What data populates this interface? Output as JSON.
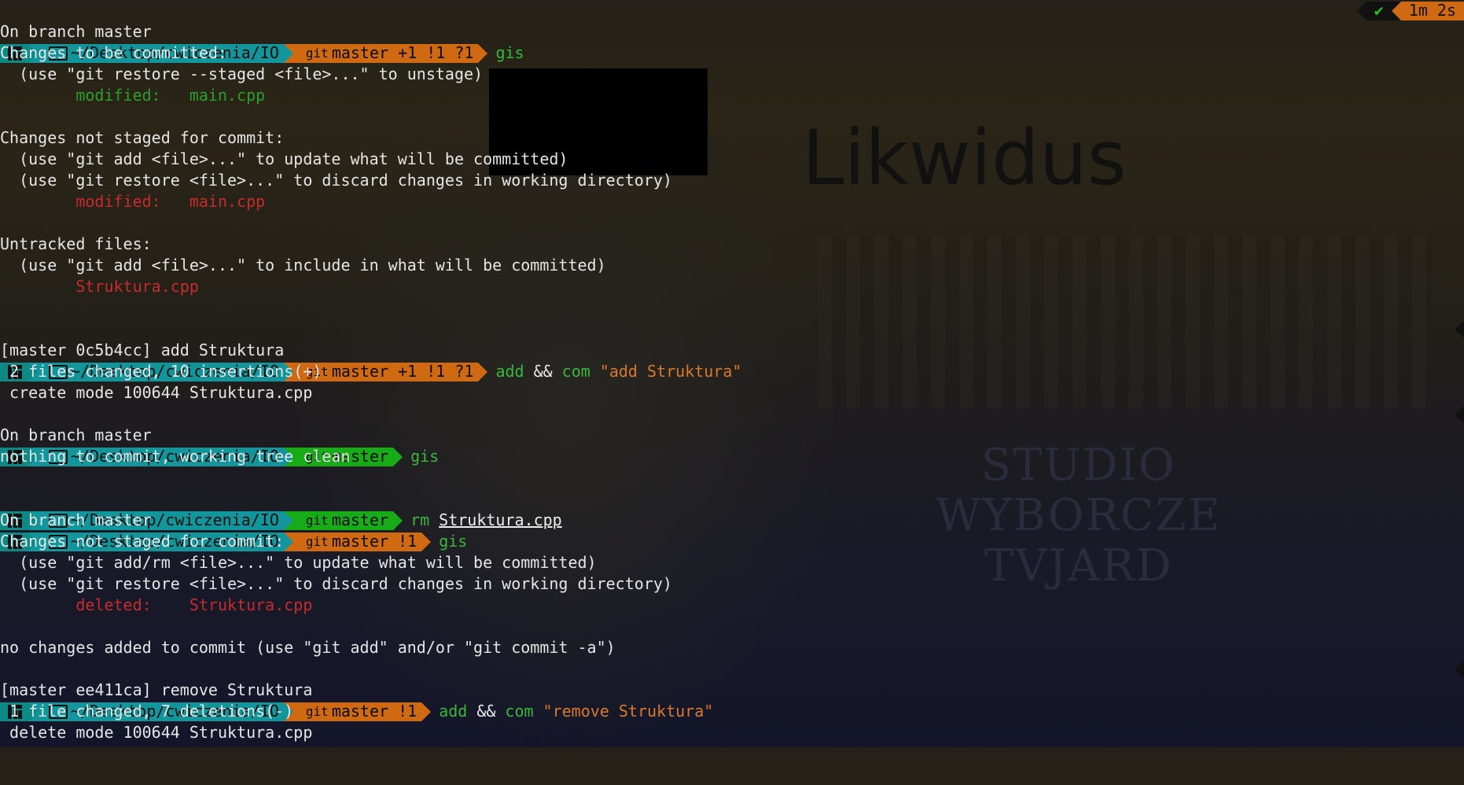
{
  "background": {
    "title": "Likwidus",
    "studio_lines": [
      "STUDIO",
      "WYBORCZE",
      "TVJARD"
    ]
  },
  "prompt": {
    "dir": "~/Desktop/cwiczenia/IO",
    "git_label": "git"
  },
  "right_status": {
    "ok": "✔",
    "time": "1m 2s"
  },
  "lines": {
    "p1": {
      "branch": "master +1 !1 ?1",
      "cmd": "gis"
    },
    "l2": "On branch master",
    "l3": "Changes to be committed:",
    "l4": "  (use \"git restore --staged <file>...\" to unstage)",
    "l5_label": "        modified:   ",
    "l5_file": "main.cpp",
    "l7": "Changes not staged for commit:",
    "l8": "  (use \"git add <file>...\" to update what will be committed)",
    "l9": "  (use \"git restore <file>...\" to discard changes in working directory)",
    "l10_label": "        modified:   ",
    "l10_file": "main.cpp",
    "l12": "Untracked files:",
    "l13": "  (use \"git add <file>...\" to include in what will be committed)",
    "l14": "        Struktura.cpp",
    "p2": {
      "branch": "master +1 !1 ?1",
      "cmd1": "add",
      "op": "&&",
      "cmd2": "com",
      "arg": "\"add Struktura\""
    },
    "l16": "[master 0c5b4cc] add Struktura",
    "l17": " 2 files changed, 10 insertions(+)",
    "l18": " create mode 100644 Struktura.cpp",
    "p3": {
      "branch": "master",
      "cmd": "gis"
    },
    "l20": "On branch master",
    "l21": "nothing to commit, working tree clean",
    "p4": {
      "branch": "master",
      "cmd": "rm",
      "arg": "Struktura.cpp"
    },
    "p5": {
      "branch": "master !1",
      "cmd": "gis"
    },
    "l24": "On branch master",
    "l25": "Changes not staged for commit:",
    "l26": "  (use \"git add/rm <file>...\" to update what will be committed)",
    "l27": "  (use \"git restore <file>...\" to discard changes in working directory)",
    "l28_label": "        deleted:    ",
    "l28_file": "Struktura.cpp",
    "l30": "no changes added to commit (use \"git add\" and/or \"git commit -a\")",
    "p6": {
      "branch": "master !1",
      "cmd1": "add",
      "op": "&&",
      "cmd2": "com",
      "arg": "\"remove Struktura\""
    },
    "l32": "[master ee411ca] remove Struktura",
    "l33": " 1 file changed, 7 deletions(-)",
    "l34": " delete mode 100644 Struktura.cpp"
  },
  "colors": {
    "segment_teal": "#12959b",
    "segment_orange": "#cf6a12",
    "segment_green": "#18ab18",
    "cmd_green": "#37b83a",
    "string_orange": "#d87a2a",
    "error_red": "#c62c2c"
  },
  "icons": {
    "os": "manjaro-logo-icon",
    "dir": "folder-open-icon",
    "git": "git-branch-icon",
    "ok": "checkmark-icon"
  }
}
